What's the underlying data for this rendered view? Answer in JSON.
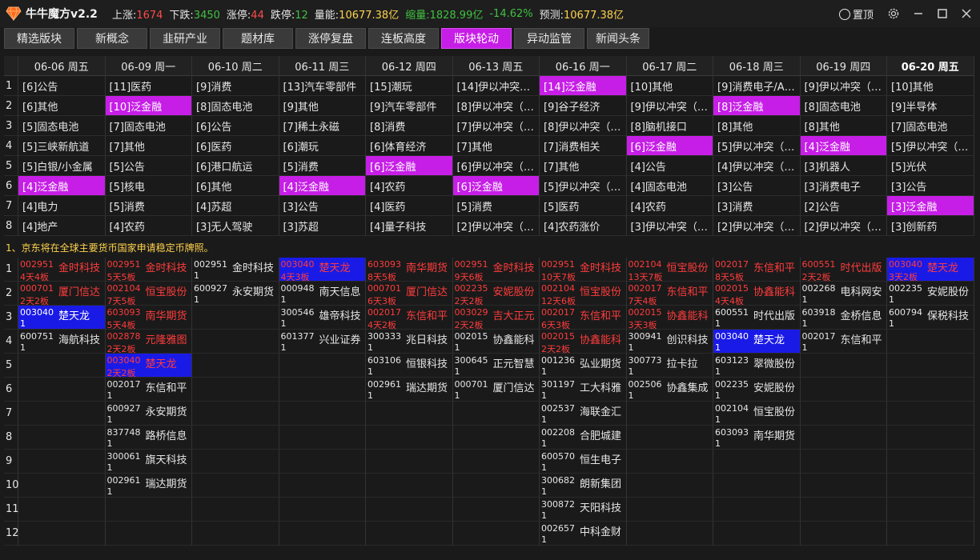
{
  "app": {
    "title": "牛牛魔方v2.2",
    "stats": [
      {
        "label": "上涨:",
        "value": "1674",
        "color": "red"
      },
      {
        "label": "下跌:",
        "value": "3450",
        "color": "green"
      },
      {
        "label": "涨停:",
        "value": "44",
        "color": "red"
      },
      {
        "label": "跌停:",
        "value": "12",
        "color": "green"
      },
      {
        "label": "量能:",
        "value": "10677.38亿",
        "color": "yellow"
      },
      {
        "label": "缩量:",
        "value": "1828.99亿",
        "color": "green",
        "label_color": "green"
      },
      {
        "label": "",
        "value": "-14.62%",
        "color": "green"
      },
      {
        "label": "预测:",
        "value": "10677.38亿",
        "color": "yellow"
      }
    ],
    "pin_label": "置顶"
  },
  "tabs": [
    {
      "label": "精选版块",
      "active": false
    },
    {
      "label": "新概念",
      "active": false
    },
    {
      "label": "韭研产业",
      "active": false
    },
    {
      "label": "题材库",
      "active": false
    },
    {
      "label": "涨停复盘",
      "active": false
    },
    {
      "label": "连板高度",
      "active": false
    },
    {
      "label": "版块轮动",
      "active": true
    },
    {
      "label": "异动监管",
      "active": false
    },
    {
      "label": "新闻头条",
      "active": false
    }
  ],
  "sector_table": {
    "columns": [
      "06-06 周五",
      "06-09 周一",
      "06-10 周二",
      "06-11 周三",
      "06-12 周四",
      "06-13 周五",
      "06-16 周一",
      "06-17 周二",
      "06-18 周三",
      "06-19 周四",
      "06-20 周五"
    ],
    "row_numbers": [
      "1",
      "2",
      "3",
      "4",
      "5",
      "6",
      "7",
      "8"
    ],
    "rows": [
      [
        "[6]公告",
        "[11]医药",
        "[9]消费",
        "[13]汽车零部件",
        "[15]潮玩",
        "[14]伊以冲突…",
        "[14]泛金融",
        "[10]其他",
        "[9]消费电子/A…",
        "[9]伊以冲突（…",
        "[10]其他"
      ],
      [
        "[6]其他",
        "[10]泛金融",
        "[8]固态电池",
        "[9]其他",
        "[9]汽车零部件",
        "[8]伊以冲突（…",
        "[9]谷子经济",
        "[9]伊以冲突（…",
        "[8]泛金融",
        "[8]固态电池",
        "[9]半导体"
      ],
      [
        "[5]固态电池",
        "[7]固态电池",
        "[6]公告",
        "[7]稀土永磁",
        "[8]消费",
        "[7]伊以冲突（…",
        "[8]伊以冲突（…",
        "[8]脑机接口",
        "[8]其他",
        "[8]其他",
        "[7]固态电池"
      ],
      [
        "[5]三峡新航道",
        "[7]其他",
        "[6]医药",
        "[6]潮玩",
        "[6]体育经济",
        "[7]其他",
        "[7]消费相关",
        "[6]泛金融",
        "[5]伊以冲突（…",
        "[4]泛金融",
        "[5]伊以冲突（…"
      ],
      [
        "[5]白银/小金属",
        "[5]公告",
        "[6]港口航运",
        "[5]消费",
        "[6]泛金融",
        "[6]伊以冲突（…",
        "[7]其他",
        "[4]公告",
        "[4]伊以冲突（…",
        "[3]机器人",
        "[5]光伏"
      ],
      [
        "[4]泛金融",
        "[5]核电",
        "[6]其他",
        "[4]泛金融",
        "[4]农药",
        "[6]泛金融",
        "[5]伊以冲突（…",
        "[4]固态电池",
        "[3]公告",
        "[3]消费电子",
        "[3]公告"
      ],
      [
        "[4]电力",
        "[5]消费",
        "[4]苏超",
        "[3]公告",
        "[4]医药",
        "[5]消费",
        "[5]医药",
        "[4]农药",
        "[3]消费",
        "[2]公告",
        "[3]泛金融"
      ],
      [
        "[4]地产",
        "[4]农药",
        "[3]无人驾驶",
        "[3]苏超",
        "[4]量子科技",
        "[2]伊以冲突（…",
        "[4]农药涨价",
        "[3]伊以冲突（…",
        "[2]伊以冲突（…",
        "[2]伊以冲突（…",
        "[3]创新药"
      ]
    ],
    "highlights": [
      [
        0,
        6
      ],
      [
        1,
        1
      ],
      [
        1,
        8
      ],
      [
        3,
        7
      ],
      [
        3,
        9
      ],
      [
        4,
        4
      ],
      [
        5,
        0
      ],
      [
        5,
        3
      ],
      [
        5,
        5
      ],
      [
        6,
        10
      ]
    ]
  },
  "news": {
    "text": "1、京东将在全球主要货币国家申请稳定币牌照。"
  },
  "stock_table": {
    "row_numbers": [
      "1",
      "2",
      "3",
      "4",
      "5",
      "6",
      "7",
      "8",
      "9",
      "10",
      "11",
      "12"
    ],
    "columns": [
      [
        {
          "code": "002951",
          "name": "金时科技",
          "sub": "4天4板",
          "c": "r"
        },
        {
          "code": "000701",
          "name": "厦门信达",
          "sub": "2天2板",
          "c": "r"
        },
        {
          "code": "003040",
          "name": "楚天龙",
          "sub": "1",
          "c": "w",
          "blue": true
        },
        {
          "code": "600751",
          "name": "海航科技",
          "sub": "1",
          "c": "w"
        }
      ],
      [
        {
          "code": "002951",
          "name": "金时科技",
          "sub": "5天5板",
          "c": "r"
        },
        {
          "code": "002104",
          "name": "恒宝股份",
          "sub": "7天5板",
          "c": "r"
        },
        {
          "code": "603093",
          "name": "南华期货",
          "sub": "5天4板",
          "c": "r"
        },
        {
          "code": "002878",
          "name": "元隆雅图",
          "sub": "2天2板",
          "c": "r"
        },
        {
          "code": "003040",
          "name": "楚天龙",
          "sub": "2天2板",
          "c": "r",
          "blue": true
        },
        {
          "code": "002017",
          "name": "东信和平",
          "sub": "1",
          "c": "w"
        },
        {
          "code": "600927",
          "name": "永安期货",
          "sub": "1",
          "c": "w"
        },
        {
          "code": "837748",
          "name": "路桥信息",
          "sub": "1",
          "c": "w"
        },
        {
          "code": "300061",
          "name": "旗天科技",
          "sub": "1",
          "c": "w"
        },
        {
          "code": "002961",
          "name": "瑞达期货",
          "sub": "1",
          "c": "w"
        }
      ],
      [
        {
          "code": "002951",
          "name": "金时科技",
          "sub": "1",
          "c": "w"
        },
        {
          "code": "600927",
          "name": "永安期货",
          "sub": "1",
          "c": "w"
        }
      ],
      [
        {
          "code": "003040",
          "name": "楚天龙",
          "sub": "4天3板",
          "c": "r",
          "blue": true
        },
        {
          "code": "000948",
          "name": "南天信息",
          "sub": "1",
          "c": "w"
        },
        {
          "code": "300546",
          "name": "雄帝科技",
          "sub": "1",
          "c": "w"
        },
        {
          "code": "601377",
          "name": "兴业证券",
          "sub": "1",
          "c": "w"
        }
      ],
      [
        {
          "code": "603093",
          "name": "南华期货",
          "sub": "8天5板",
          "c": "r"
        },
        {
          "code": "000701",
          "name": "厦门信达",
          "sub": "6天3板",
          "c": "r"
        },
        {
          "code": "002017",
          "name": "东信和平",
          "sub": "4天2板",
          "c": "r"
        },
        {
          "code": "300333",
          "name": "兆日科技",
          "sub": "1",
          "c": "w"
        },
        {
          "code": "603106",
          "name": "恒银科技",
          "sub": "1",
          "c": "w"
        },
        {
          "code": "002961",
          "name": "瑞达期货",
          "sub": "1",
          "c": "w"
        }
      ],
      [
        {
          "code": "002951",
          "name": "金时科技",
          "sub": "9天6板",
          "c": "r"
        },
        {
          "code": "002235",
          "name": "安妮股份",
          "sub": "2天2板",
          "c": "r"
        },
        {
          "code": "003029",
          "name": "吉大正元",
          "sub": "2天2板",
          "c": "r"
        },
        {
          "code": "002015",
          "name": "协鑫能科",
          "sub": "1",
          "c": "w"
        },
        {
          "code": "300645",
          "name": "正元智慧",
          "sub": "1",
          "c": "w"
        },
        {
          "code": "000701",
          "name": "厦门信达",
          "sub": "1",
          "c": "w"
        }
      ],
      [
        {
          "code": "002951",
          "name": "金时科技",
          "sub": "10天7板",
          "c": "r"
        },
        {
          "code": "002104",
          "name": "恒宝股份",
          "sub": "12天6板",
          "c": "r"
        },
        {
          "code": "002017",
          "name": "东信和平",
          "sub": "6天3板",
          "c": "r"
        },
        {
          "code": "002015",
          "name": "协鑫能科",
          "sub": "2天2板",
          "c": "r"
        },
        {
          "code": "001236",
          "name": "弘业期货",
          "sub": "1",
          "c": "w"
        },
        {
          "code": "301197",
          "name": "工大科雅",
          "sub": "1",
          "c": "w"
        },
        {
          "code": "002537",
          "name": "海联金汇",
          "sub": "1",
          "c": "w"
        },
        {
          "code": "002208",
          "name": "合肥城建",
          "sub": "1",
          "c": "w"
        },
        {
          "code": "600570",
          "name": "恒生电子",
          "sub": "1",
          "c": "w"
        },
        {
          "code": "300682",
          "name": "朗新集团",
          "sub": "1",
          "c": "w"
        },
        {
          "code": "300872",
          "name": "天阳科技",
          "sub": "1",
          "c": "w"
        },
        {
          "code": "002657",
          "name": "中科金财",
          "sub": "1",
          "c": "w"
        }
      ],
      [
        {
          "code": "002104",
          "name": "恒宝股份",
          "sub": "13天7板",
          "c": "r"
        },
        {
          "code": "002017",
          "name": "东信和平",
          "sub": "7天4板",
          "c": "r"
        },
        {
          "code": "002015",
          "name": "协鑫能科",
          "sub": "3天3板",
          "c": "r"
        },
        {
          "code": "300941",
          "name": "创识科技",
          "sub": "1",
          "c": "w"
        },
        {
          "code": "300773",
          "name": "拉卡拉",
          "sub": "1",
          "c": "w"
        },
        {
          "code": "002506",
          "name": "协鑫集成",
          "sub": "1",
          "c": "w"
        }
      ],
      [
        {
          "code": "002017",
          "name": "东信和平",
          "sub": "8天5板",
          "c": "r"
        },
        {
          "code": "002015",
          "name": "协鑫能科",
          "sub": "4天4板",
          "c": "r"
        },
        {
          "code": "600551",
          "name": "时代出版",
          "sub": "1",
          "c": "w"
        },
        {
          "code": "003040",
          "name": "楚天龙",
          "sub": "1",
          "c": "w",
          "blue": true
        },
        {
          "code": "603123",
          "name": "翠微股份",
          "sub": "1",
          "c": "w"
        },
        {
          "code": "002235",
          "name": "安妮股份",
          "sub": "1",
          "c": "w"
        },
        {
          "code": "002104",
          "name": "恒宝股份",
          "sub": "1",
          "c": "w"
        },
        {
          "code": "603093",
          "name": "南华期货",
          "sub": "1",
          "c": "w"
        }
      ],
      [
        {
          "code": "600551",
          "name": "时代出版",
          "sub": "2天2板",
          "c": "r"
        },
        {
          "code": "002268",
          "name": "电科网安",
          "sub": "1",
          "c": "w"
        },
        {
          "code": "603918",
          "name": "金桥信息",
          "sub": "1",
          "c": "w"
        },
        {
          "code": "002017",
          "name": "东信和平",
          "sub": "1",
          "c": "w"
        }
      ],
      [
        {
          "code": "003040",
          "name": "楚天龙",
          "sub": "3天2板",
          "c": "r",
          "blue": true
        },
        {
          "code": "002235",
          "name": "安妮股份",
          "sub": "1",
          "c": "w"
        },
        {
          "code": "600794",
          "name": "保税科技",
          "sub": "1",
          "c": "w"
        }
      ]
    ]
  }
}
